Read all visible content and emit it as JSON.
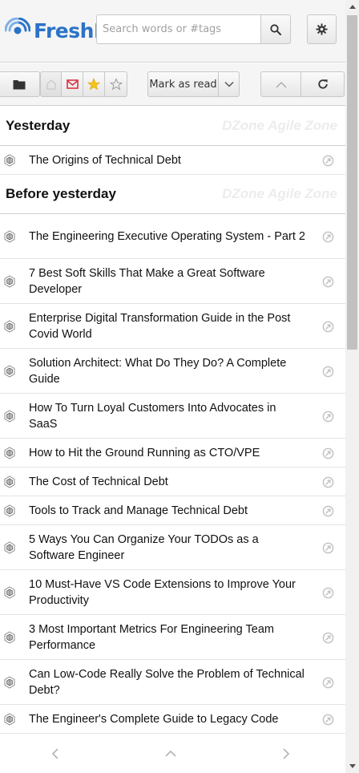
{
  "header": {
    "logo_text": "FreshR",
    "search_placeholder": "Search words or #tags"
  },
  "toolbar": {
    "mark_as_read_label": "Mark as read"
  },
  "sections": [
    {
      "title": "Yesterday",
      "source": "DZone Agile Zone",
      "items": [
        {
          "title": "The Origins of Technical Debt"
        }
      ]
    },
    {
      "title": "Before yesterday",
      "source": "DZone Agile Zone",
      "items": [
        {
          "title": "The Engineering Executive Operating System - Part 2"
        },
        {
          "title": "7 Best Soft Skills That Make a Great Software Developer"
        },
        {
          "title": "Enterprise Digital Transformation Guide in the Post Covid World"
        },
        {
          "title": "Solution Architect: What Do They Do? A Complete Guide"
        },
        {
          "title": "How To Turn Loyal Customers Into Advocates in SaaS"
        },
        {
          "title": "How to Hit the Ground Running as CTO/VPE"
        },
        {
          "title": "The Cost of Technical Debt"
        },
        {
          "title": "Tools to Track and Manage Technical Debt"
        },
        {
          "title": "5 Ways You Can Organize Your TODOs as a Software Engineer"
        },
        {
          "title": "10 Must-Have VS Code Extensions to Improve Your Productivity"
        },
        {
          "title": "3 Most Important Metrics For Engineering Team Performance"
        },
        {
          "title": "Can Low-Code Really Solve the Problem of Technical Debt?"
        },
        {
          "title": "The Engineer's Complete Guide to Legacy Code"
        }
      ]
    }
  ],
  "icons": {
    "logo": "freshrss-logo-icon",
    "search": "search-icon",
    "settings": "gear-icon",
    "folder": "folder-icon",
    "home": "home-icon",
    "unread": "mail-icon",
    "favorites": "star-icon",
    "non_favorites": "star-outline-icon",
    "caret": "chevron-down-icon",
    "up": "chevron-up-icon",
    "refresh": "refresh-icon",
    "feed": "feed-icon",
    "share": "share-icon",
    "prev": "chevron-left-icon",
    "next": "chevron-right-icon"
  },
  "colors": {
    "brand": "#2b73c7",
    "star": "#f5c518",
    "mail": "#d9333f"
  }
}
